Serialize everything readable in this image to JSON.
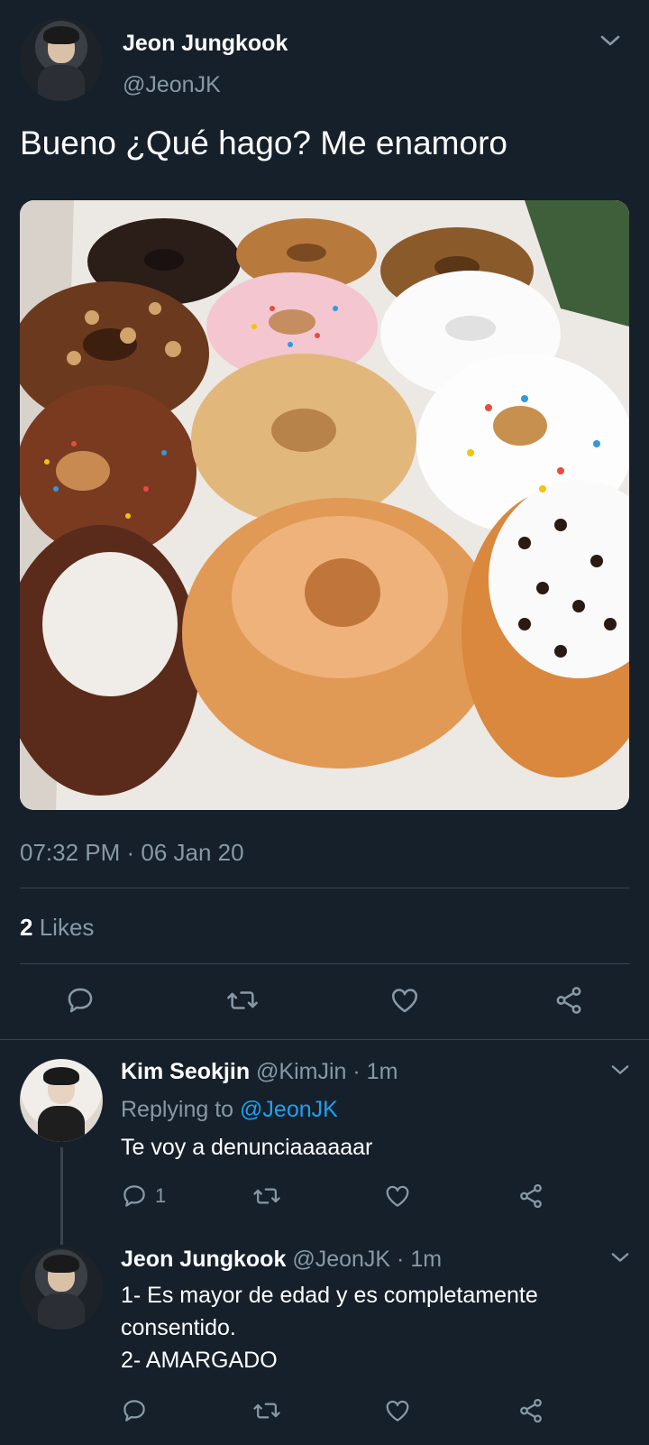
{
  "main_tweet": {
    "author_name": "Jeon Jungkook",
    "author_handle": "@JeonJK",
    "text": "Bueno ¿Qué hago? Me enamoro",
    "timestamp": "07:32 PM · 06 Jan 20",
    "likes_count": "2",
    "likes_label": "Likes",
    "media_icon": "donuts-photo",
    "actions": [
      "reply-icon",
      "retweet-icon",
      "like-icon",
      "share-icon"
    ]
  },
  "replies": [
    {
      "author_name": "Kim Seokjin",
      "author_handle": "@KimJin",
      "time": "· 1m",
      "replying_prefix": "Replying to",
      "replying_mention": "@JeonJK",
      "text": "Te voy a denunciaaaaaar",
      "reply_count": "1"
    },
    {
      "author_name": "Jeon Jungkook",
      "author_handle": "@JeonJK",
      "time": "· 1m",
      "text_lines": [
        "1- Es mayor de edad y es completamente",
        "consentido.",
        "2- AMARGADO"
      ]
    }
  ],
  "colors": {
    "background": "#15202b",
    "secondary_text": "#8899a6",
    "link": "#1da1f2",
    "divider": "#38444d"
  }
}
